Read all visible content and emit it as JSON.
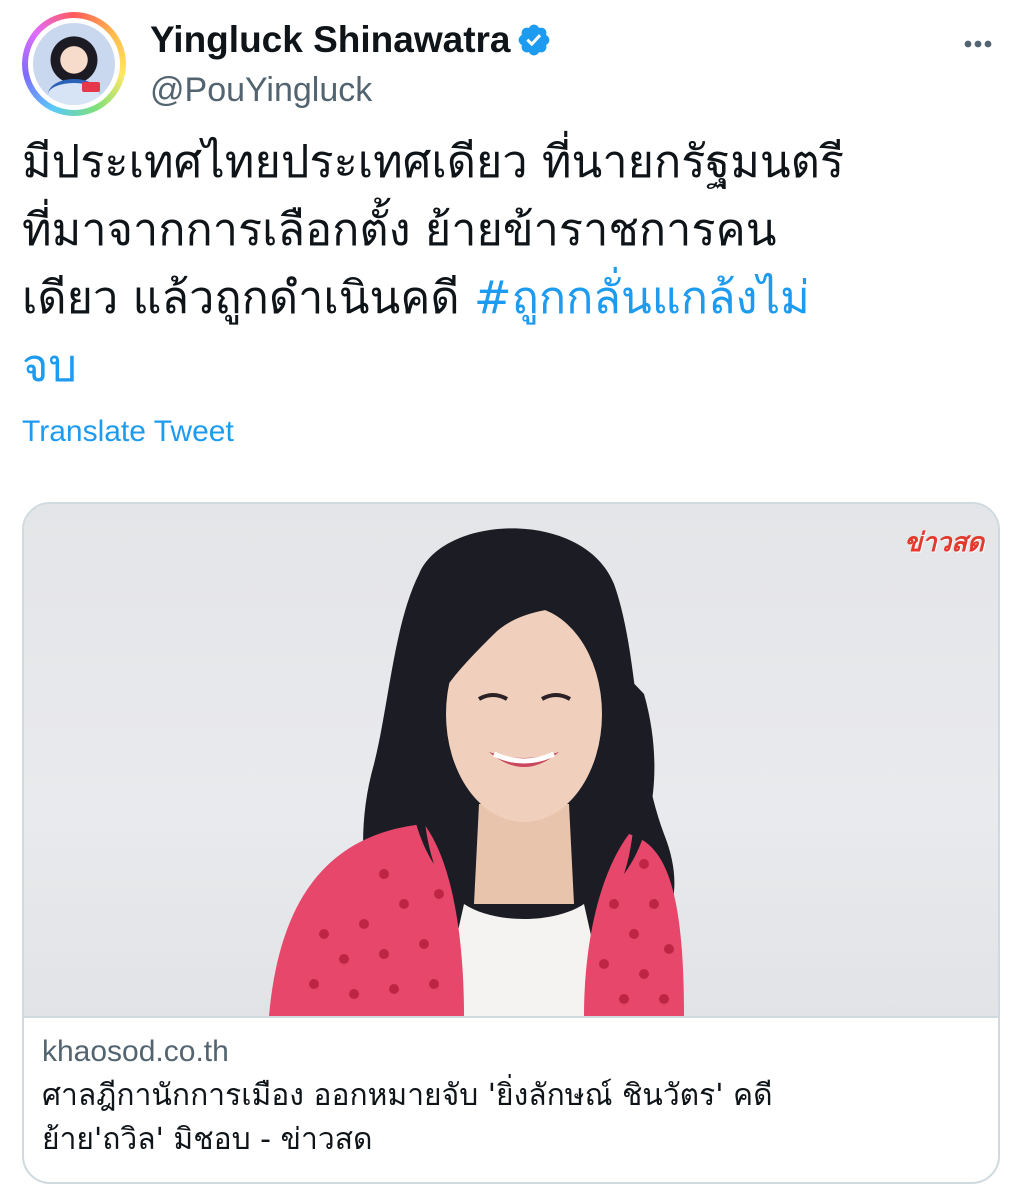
{
  "tweet": {
    "author": {
      "display_name": "Yingluck Shinawatra",
      "handle": "@PouYingluck",
      "verified_icon": "verified-badge-icon",
      "avatar": "profile-photo"
    },
    "more_icon": "more-horizontal-icon",
    "text_lines": [
      "มีประเทศไทยประเทศเดียว ที่นายกรัฐมนตรี",
      "ที่มาจากการเลือกตั้ง ย้ายข้าราชการคน",
      "เดียว แล้วถูกดำเนินคดี "
    ],
    "hashtag_part1": "#ถูกกลั่นแกล้งไม่",
    "hashtag_part2": "จบ",
    "translate_label": "Translate Tweet",
    "colors": {
      "link_blue": "#1d9bf0",
      "text": "#0f1419",
      "secondary": "#536471",
      "border": "#cfd9de",
      "watermark": "#e23a2d"
    }
  },
  "link_card": {
    "image": "news-photo-portrait",
    "watermark": "ข่าวสด",
    "domain": "khaosod.co.th",
    "title_line1": "ศาลฎีกานักการเมือง ออกหมายจับ 'ยิ่งลักษณ์ ชินวัตร' คดี",
    "title_line2": "ย้าย'ถวิล' มิชอบ - ข่าวสด"
  }
}
